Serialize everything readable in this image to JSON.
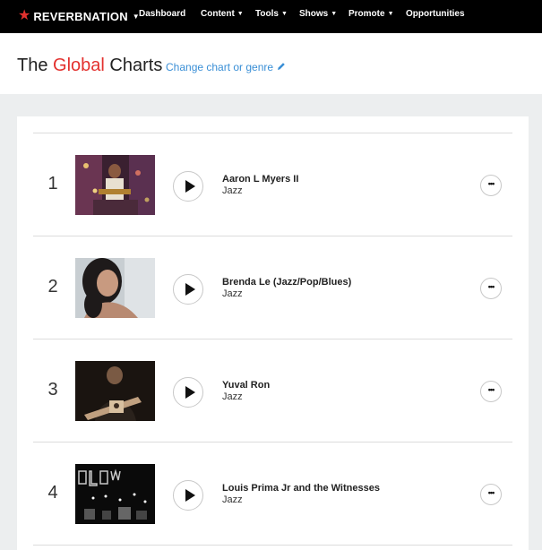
{
  "nav": {
    "brand": "REVERBNATION",
    "items": [
      {
        "label": "Dashboard",
        "dropdown": false
      },
      {
        "label": "Content",
        "dropdown": true
      },
      {
        "label": "Tools",
        "dropdown": true
      },
      {
        "label": "Shows",
        "dropdown": true
      },
      {
        "label": "Promote",
        "dropdown": true
      },
      {
        "label": "Opportunities",
        "dropdown": false
      }
    ]
  },
  "header": {
    "title_prefix": "The",
    "title_highlight": "Global",
    "title_suffix": "Charts",
    "change_link": "Change chart or genre"
  },
  "chart": {
    "rows": [
      {
        "rank": "1",
        "artist": "Aaron L Myers II",
        "genre": "Jazz"
      },
      {
        "rank": "2",
        "artist": "Brenda Le (Jazz/Pop/Blues)",
        "genre": "Jazz"
      },
      {
        "rank": "3",
        "artist": "Yuval Ron",
        "genre": "Jazz"
      },
      {
        "rank": "4",
        "artist": "Louis Prima Jr and the Witnesses",
        "genre": "Jazz"
      }
    ]
  },
  "colors": {
    "brand_red": "#e3312e",
    "link_blue": "#3a8fd6",
    "nav_bg": "#000000"
  }
}
